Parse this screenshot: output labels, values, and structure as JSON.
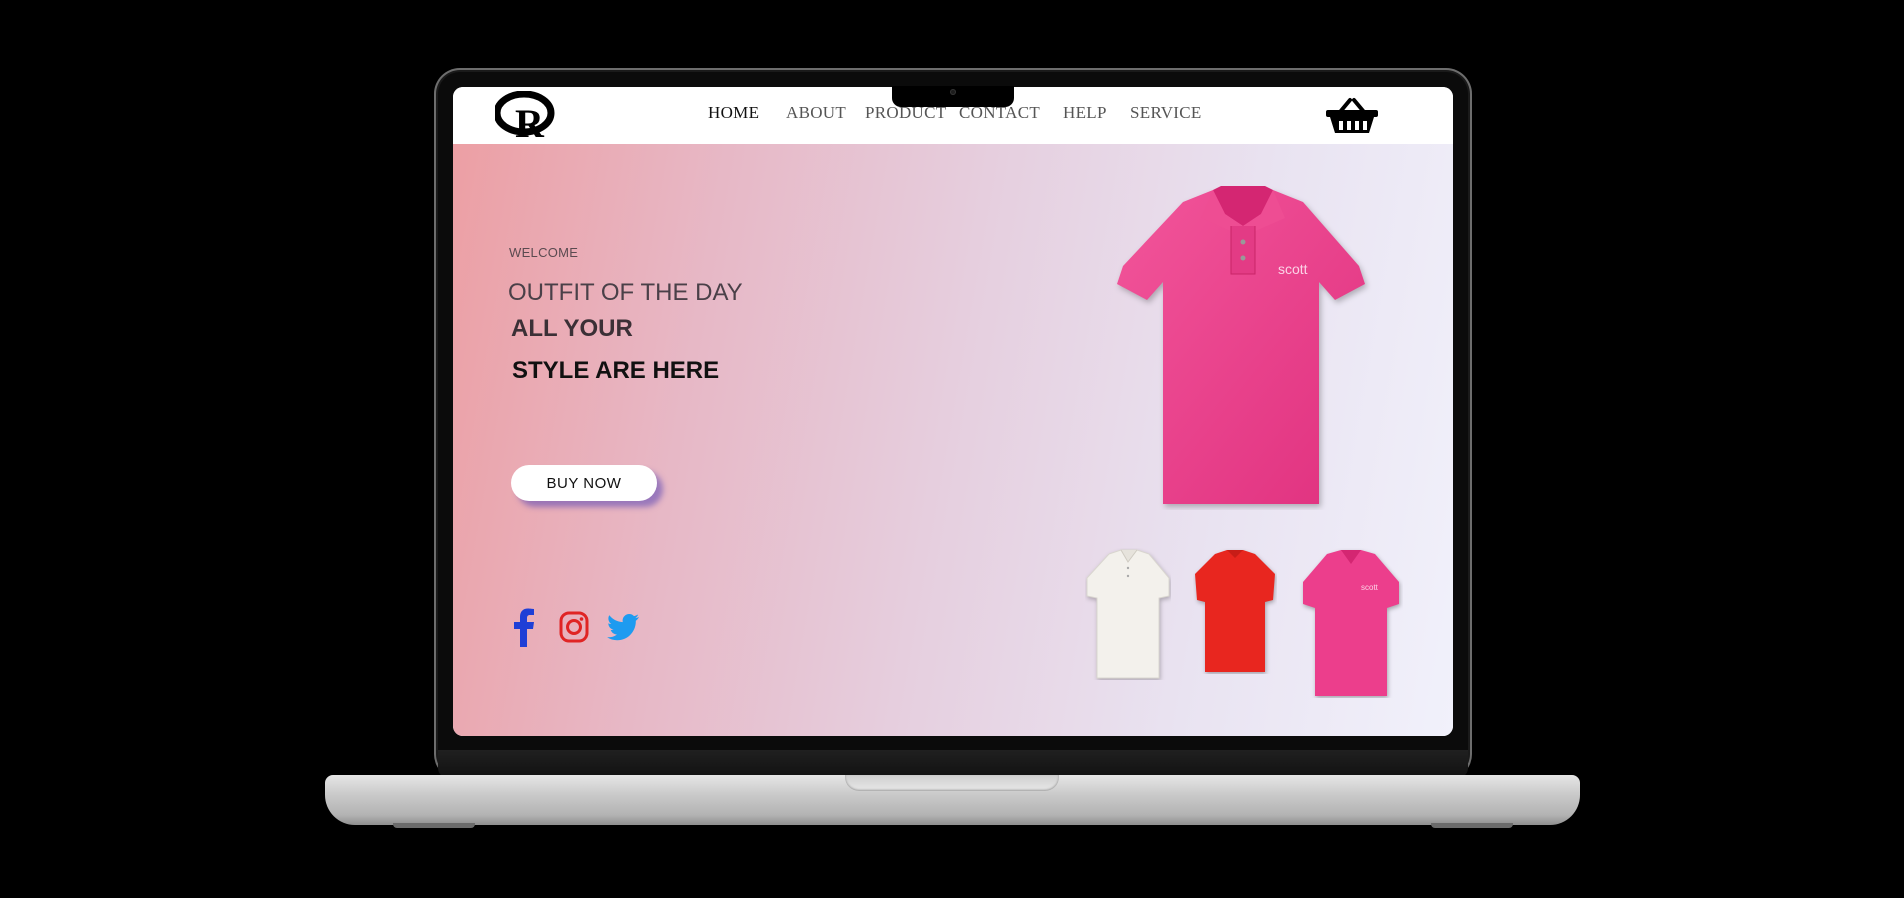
{
  "logo": {
    "letter": "R",
    "icon": "r-logo-icon"
  },
  "nav": {
    "items": [
      {
        "label": "HOME",
        "active": true
      },
      {
        "label": "ABOUT",
        "active": false
      },
      {
        "label": "PRODUCT",
        "active": false
      },
      {
        "label": "CONTACT",
        "active": false
      },
      {
        "label": "HELP",
        "active": false
      },
      {
        "label": "SERVICE",
        "active": false
      }
    ],
    "cart_icon": "shopping-basket-icon"
  },
  "hero": {
    "welcome": "WELCOME",
    "subtitle": "OUTFIT OF THE DAY",
    "tagline_1": "ALL YOUR",
    "tagline_2": "STYLE ARE HERE",
    "cta_label": "BUY  NOW",
    "main_product": {
      "color": "#ec3e8c",
      "brand": "scott"
    },
    "thumbnails": [
      {
        "color": "#f3f1ec"
      },
      {
        "color": "#e8261f"
      },
      {
        "color": "#ec3e8c",
        "brand": "scott"
      }
    ]
  },
  "social": [
    {
      "icon": "facebook-icon",
      "color": "#1f3fd6"
    },
    {
      "icon": "instagram-icon",
      "color": "#e02424"
    },
    {
      "icon": "twitter-icon",
      "color": "#1d9bf0"
    }
  ],
  "colors": {
    "gradient_start": "#ec9fa4",
    "gradient_end": "#f1f1fb",
    "button_shadow": "#5a46b4"
  }
}
